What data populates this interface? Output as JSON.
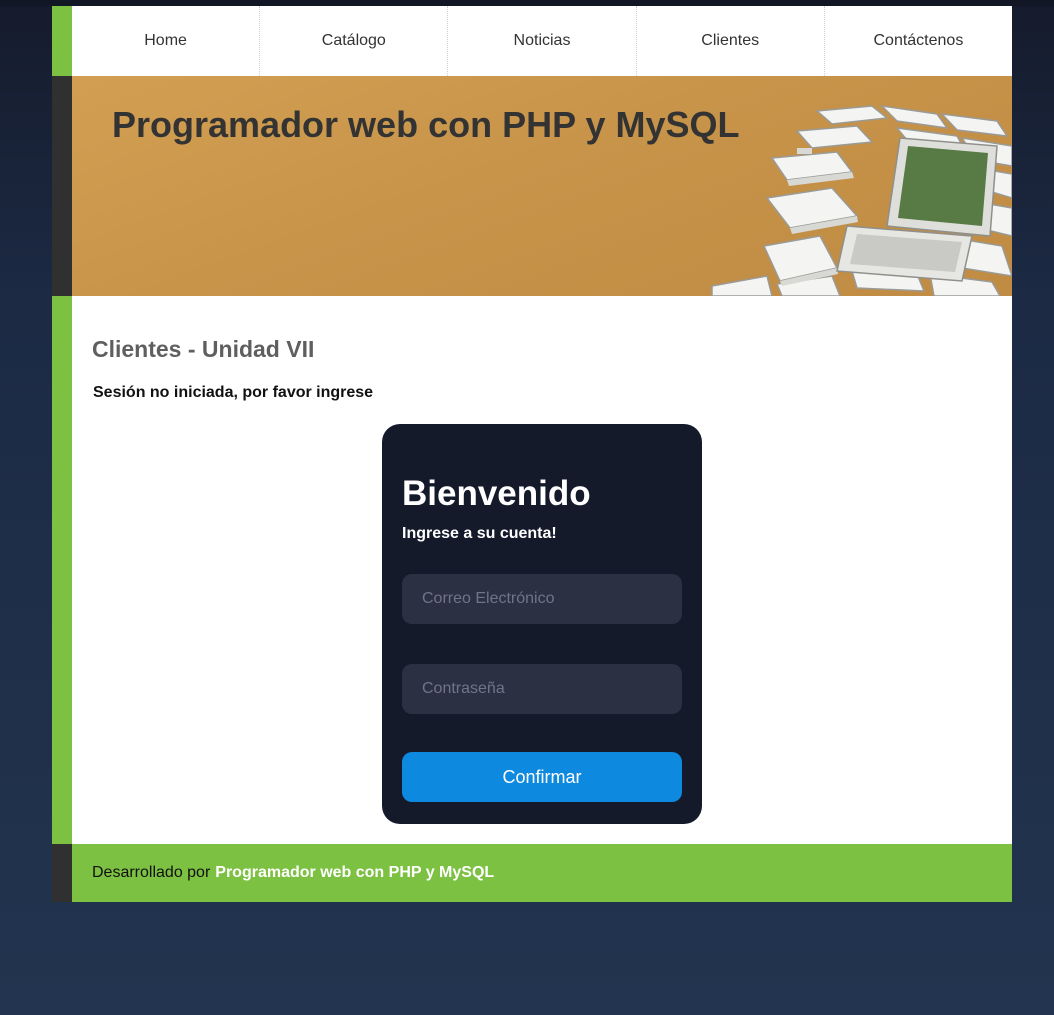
{
  "nav": {
    "items": [
      {
        "label": "Home"
      },
      {
        "label": "Catálogo"
      },
      {
        "label": "Noticias"
      },
      {
        "label": "Clientes"
      },
      {
        "label": "Contáctenos"
      }
    ]
  },
  "banner": {
    "title": "Programador web con PHP y MySQL"
  },
  "content": {
    "section_title": "Clientes - Unidad VII",
    "session_message": "Sesión no iniciada, por favor ingrese"
  },
  "login": {
    "title": "Bienvenido",
    "subtitle": "Ingrese a su cuenta!",
    "email_placeholder": "Correo Electrónico",
    "password_placeholder": "Contraseña",
    "confirm_label": "Confirmar"
  },
  "footer": {
    "prefix": "Desarrollado por",
    "link": "Programador web con PHP y MySQL"
  },
  "colors": {
    "accent_green": "#7dc142",
    "card_dark": "#151a2b",
    "button_blue": "#0e89e0",
    "banner_tan": "#c7944a"
  }
}
